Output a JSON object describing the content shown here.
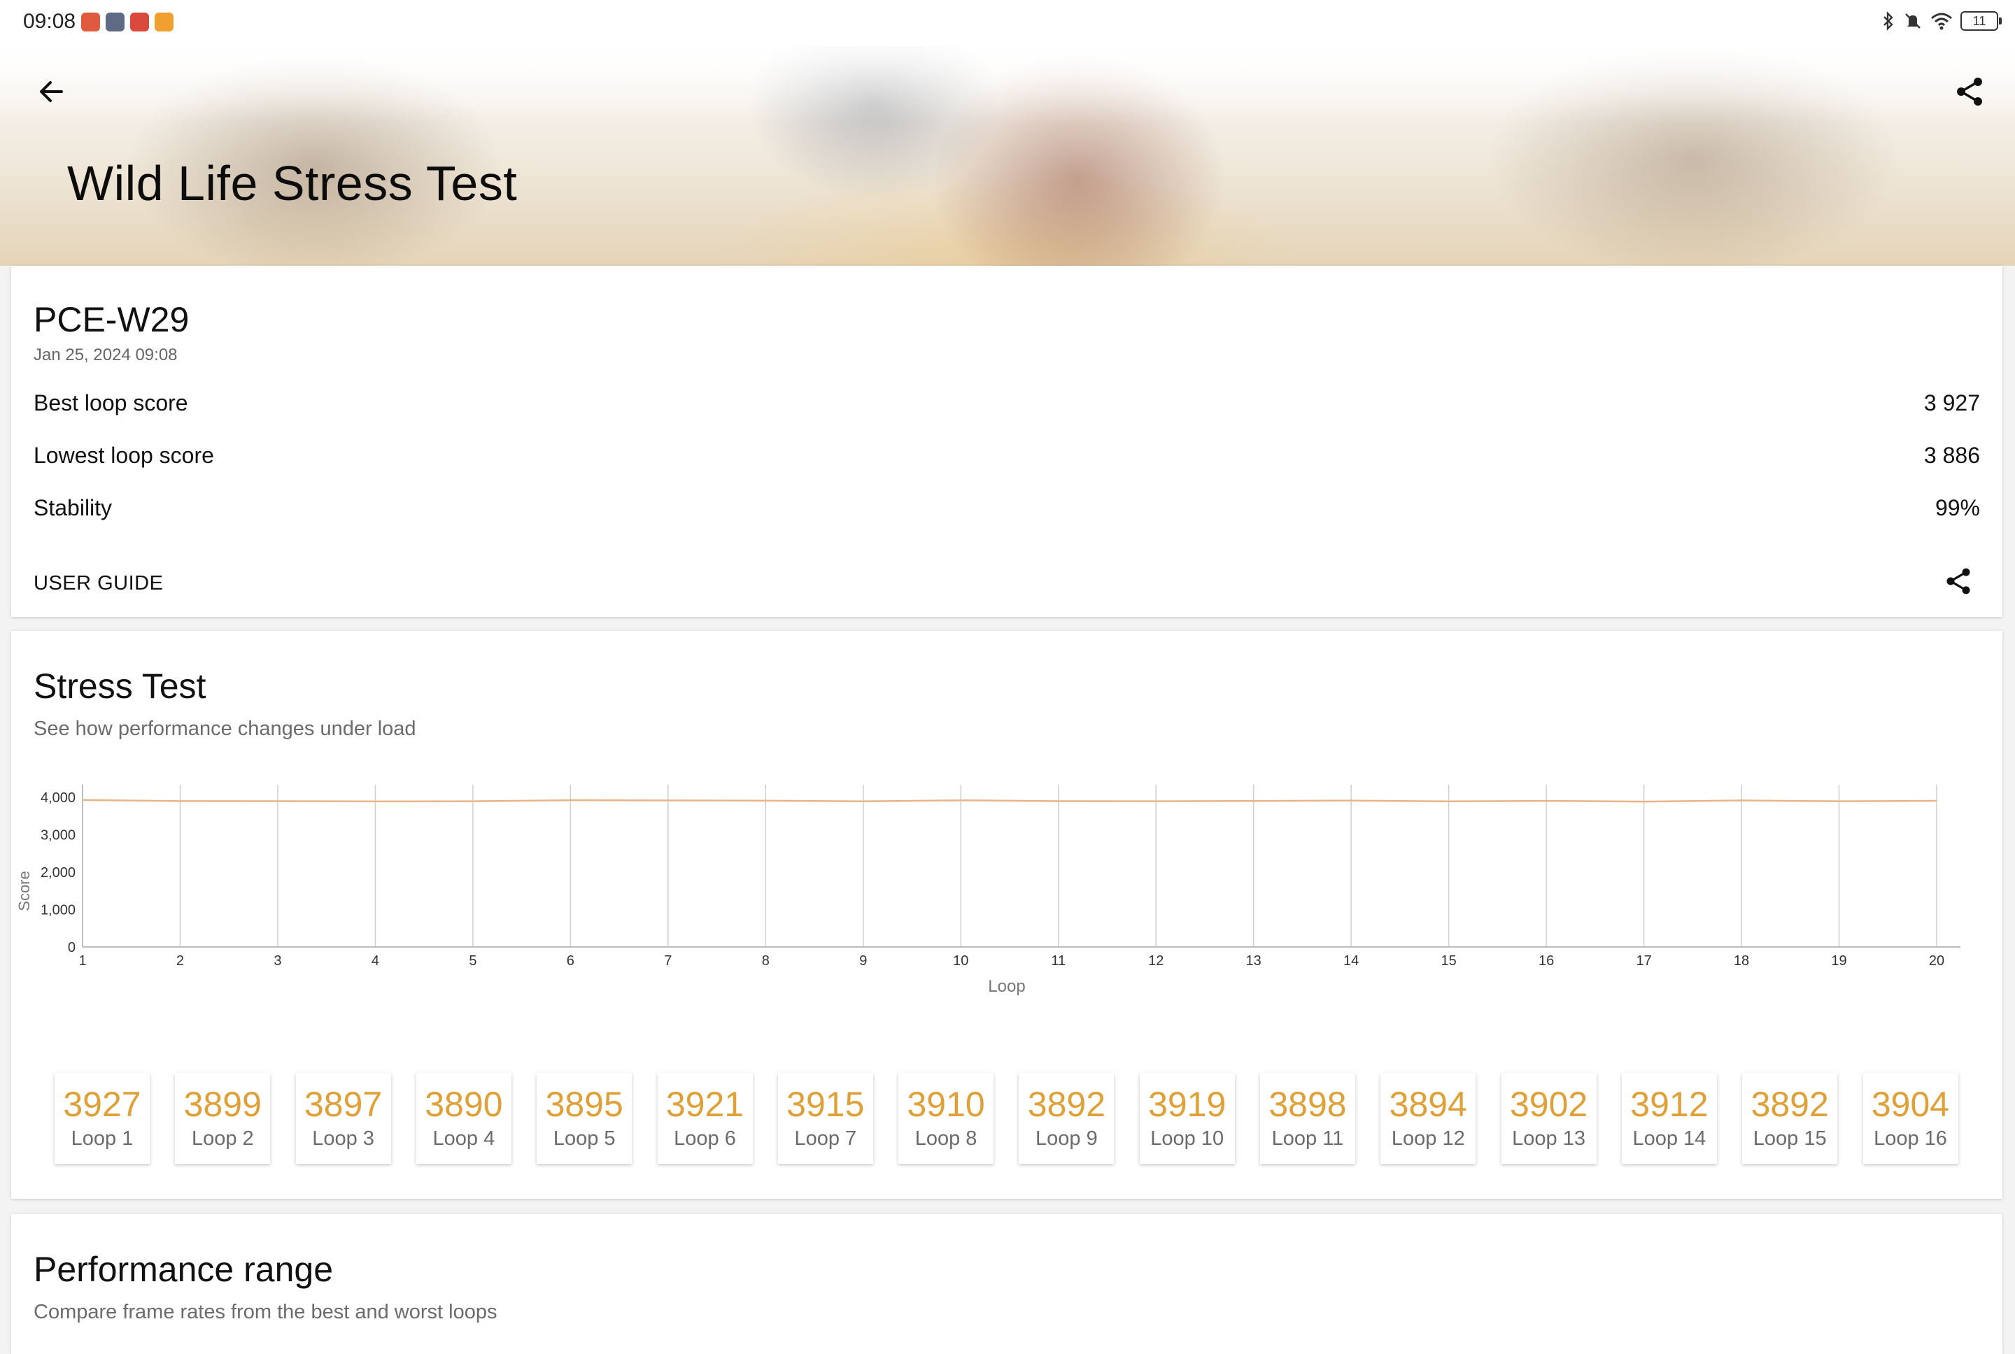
{
  "status_bar": {
    "time": "09:08",
    "battery": "11",
    "app_icon_colors": [
      "#e05a40",
      "#5f6b84",
      "#d94a3c",
      "#f0a030"
    ],
    "icons": [
      "bluetooth-icon",
      "mute-icon",
      "wifi-icon",
      "battery-icon"
    ]
  },
  "header": {
    "title": "Wild Life Stress Test",
    "back_icon": "arrow-left-icon",
    "share_icon": "share-icon"
  },
  "summary": {
    "device": "PCE-W29",
    "date": "Jan 25, 2024 09:08",
    "stats": [
      {
        "label": "Best loop score",
        "value": "3 927"
      },
      {
        "label": "Lowest loop score",
        "value": "3 886"
      },
      {
        "label": "Stability",
        "value": "99%"
      }
    ],
    "user_guide": "USER GUIDE",
    "share_icon": "share-icon"
  },
  "stress_test": {
    "title": "Stress Test",
    "subtitle": "See how performance changes under load",
    "loops": [
      {
        "score": "3927",
        "label": "Loop 1"
      },
      {
        "score": "3899",
        "label": "Loop 2"
      },
      {
        "score": "3897",
        "label": "Loop 3"
      },
      {
        "score": "3890",
        "label": "Loop 4"
      },
      {
        "score": "3895",
        "label": "Loop 5"
      },
      {
        "score": "3921",
        "label": "Loop 6"
      },
      {
        "score": "3915",
        "label": "Loop 7"
      },
      {
        "score": "3910",
        "label": "Loop 8"
      },
      {
        "score": "3892",
        "label": "Loop 9"
      },
      {
        "score": "3919",
        "label": "Loop 10"
      },
      {
        "score": "3898",
        "label": "Loop 11"
      },
      {
        "score": "3894",
        "label": "Loop 12"
      },
      {
        "score": "3902",
        "label": "Loop 13"
      },
      {
        "score": "3912",
        "label": "Loop 14"
      },
      {
        "score": "3892",
        "label": "Loop 15"
      },
      {
        "score": "3904",
        "label": "Loop 16"
      }
    ]
  },
  "performance_range": {
    "title": "Performance range",
    "subtitle": "Compare frame rates from the best and worst loops"
  },
  "chart_data": {
    "type": "line",
    "xlabel": "Loop",
    "ylabel": "Score",
    "x": [
      1,
      2,
      3,
      4,
      5,
      6,
      7,
      8,
      9,
      10,
      11,
      12,
      13,
      14,
      15,
      16,
      17,
      18,
      19,
      20
    ],
    "series": [
      {
        "values": [
          3927,
          3899,
          3897,
          3890,
          3895,
          3921,
          3915,
          3910,
          3892,
          3919,
          3898,
          3894,
          3902,
          3912,
          3892,
          3904,
          3886,
          3915,
          3895,
          3906
        ],
        "color": "#e8b48a"
      }
    ],
    "yticks": [
      0,
      1000,
      2000,
      3000,
      4000
    ],
    "ytick_labels": [
      "0",
      "1,000",
      "2,000",
      "3,000",
      "4,000"
    ],
    "xticks": [
      "1",
      "2",
      "3",
      "4",
      "5",
      "6",
      "7",
      "8",
      "9",
      "10",
      "11",
      "12",
      "13",
      "14",
      "15",
      "16",
      "17",
      "18",
      "19",
      "20"
    ],
    "ylim": [
      0,
      4000
    ],
    "xlim": [
      1,
      20
    ],
    "grid": "vertical"
  }
}
